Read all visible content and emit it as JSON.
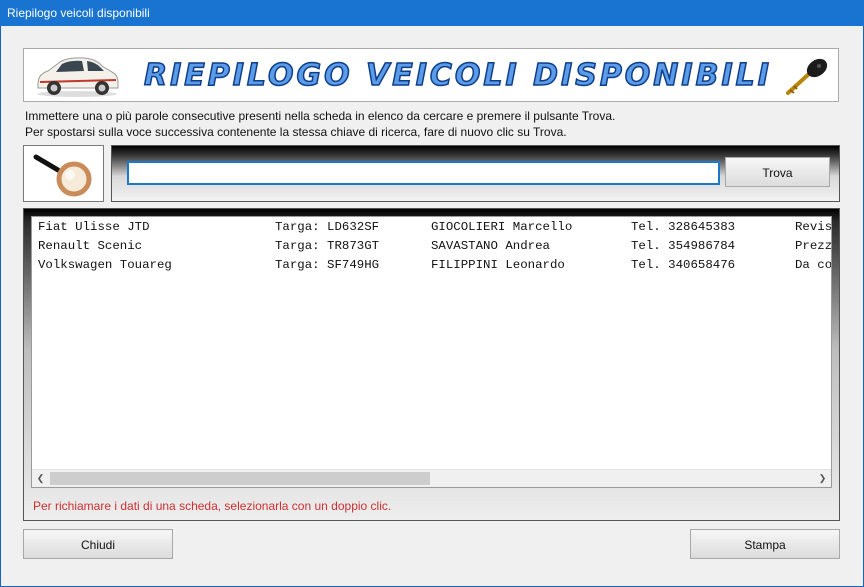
{
  "window": {
    "title": "Riepilogo veicoli disponibili"
  },
  "banner": {
    "title": "RIEPILOGO VEICOLI DISPONIBILI"
  },
  "instructions": {
    "line1": "Immettere una o più parole consecutive presenti nella scheda in elenco da cercare e premere il pulsante Trova.",
    "line2": "Per spostarsi sulla voce successiva contenente la stessa chiave di ricerca, fare di nuovo clic su Trova."
  },
  "search": {
    "value": "",
    "button_label": "Trova"
  },
  "list": {
    "rows": [
      {
        "model": "Fiat Ulisse JTD",
        "plate": "Targa: LD632SF",
        "owner": "GIOCOLIERI Marcello",
        "phone": "Tel. 328645383",
        "extra": "Revis"
      },
      {
        "model": "Renault Scenic",
        "plate": "Targa: TR873GT",
        "owner": "SAVASTANO Andrea",
        "phone": "Tel. 354986784",
        "extra": "Prezz"
      },
      {
        "model": "Volkswagen Touareg",
        "plate": "Targa: SF749HG",
        "owner": "FILIPPINI Leonardo",
        "phone": "Tel. 340658476",
        "extra": "Da co"
      }
    ],
    "scroll_left_icon": "chevron-left-icon",
    "scroll_right_icon": "chevron-right-icon"
  },
  "hint": "Per richiamare i dati di una scheda, selezionarla con un doppio clic.",
  "footer": {
    "close_label": "Chiudi",
    "print_label": "Stampa"
  },
  "colors": {
    "titlebar": "#1874d0",
    "banner_text": "#5b9be8",
    "hint_text": "#d03030",
    "input_border": "#1979ca"
  }
}
